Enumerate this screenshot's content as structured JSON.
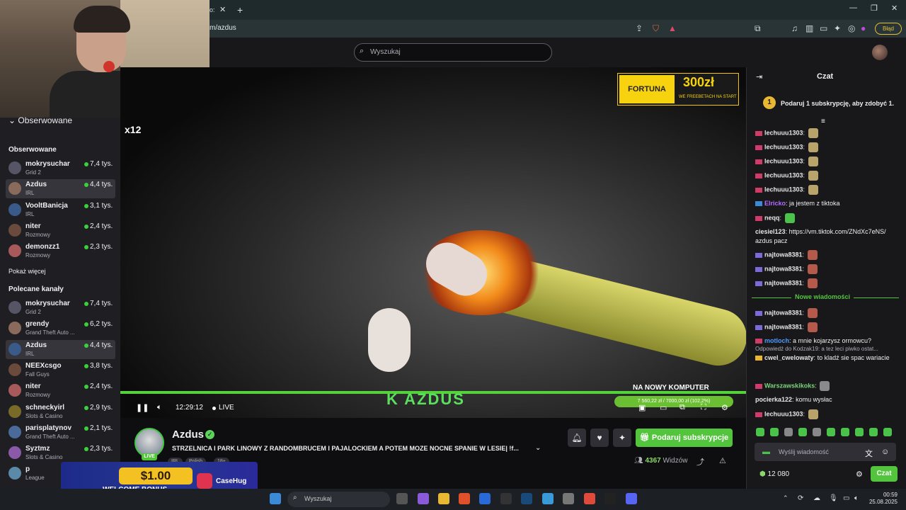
{
  "browser": {
    "tab_label": "o:",
    "url": "m/azdus",
    "error_badge": "Błąd"
  },
  "topnav": {
    "search_placeholder": "Wyszukaj"
  },
  "sidebar": {
    "followed_toggle": "Obserwowane",
    "followed_heading": "Obserwowane",
    "followed": [
      {
        "name": "mokrysuchar",
        "category": "Grid 2",
        "viewers": "7,4 tys."
      },
      {
        "name": "Azdus",
        "category": "IRL",
        "viewers": "4,4 tys."
      },
      {
        "name": "VooltBanicja",
        "category": "IRL",
        "viewers": "3,1 tys."
      },
      {
        "name": "niter",
        "category": "Rozmowy",
        "viewers": "2,4 tys."
      },
      {
        "name": "demonzz1",
        "category": "Rozmowy",
        "viewers": "2,3 tys."
      }
    ],
    "show_more": "Pokaż więcej",
    "recommended_heading": "Polecane kanały",
    "recommended": [
      {
        "name": "mokrysuchar",
        "category": "Grid 2",
        "viewers": "7,4 tys."
      },
      {
        "name": "grendy",
        "category": "Grand Theft Auto ...",
        "viewers": "6,2 tys."
      },
      {
        "name": "Azdus",
        "category": "IRL",
        "viewers": "4,4 tys."
      },
      {
        "name": "NEEXcsgo",
        "category": "Fall Guys",
        "viewers": "3,8 tys."
      },
      {
        "name": "niter",
        "category": "Rozmowy",
        "viewers": "2,4 tys."
      },
      {
        "name": "schneckyirl",
        "category": "Slots & Casino",
        "viewers": "2,9 tys."
      },
      {
        "name": "parisplatynov",
        "category": "Grand Theft Auto ...",
        "viewers": "2,1 tys."
      },
      {
        "name": "Syztmz",
        "category": "Slots & Casino",
        "viewers": "2,3 tys."
      },
      {
        "name": "p",
        "category": "League",
        "viewers": ""
      }
    ]
  },
  "video": {
    "overlay_x12": "x12",
    "sponsor_logo": "FORTUNA",
    "sponsor_amount": "300zł",
    "sponsor_sub": "WE FREEBETACH NA START",
    "overlay_brand": "K AZDUS",
    "goal_title": "NA NOWY KOMPUTER",
    "goal_progress": "7 560,22 zł / 7000,00 zł (102,2%)",
    "time": "12:29:12",
    "live_label": "LIVE"
  },
  "stream": {
    "streamer": "Azdus",
    "live_badge": "LIVE",
    "title": "STRZELNICA I PARK LINOWY Z RANDOMBRUCEM I PAJALOCKIEM A POTEM MOZE NOCNE SPANIE W LESIE| !f...",
    "tags": [
      "IRL",
      "Polish",
      "18+"
    ],
    "subscribe_label": "Podaruj subskrypcje",
    "viewer_count": "4367",
    "viewer_label": "Widzów"
  },
  "ad": {
    "amount": "$1.00",
    "bonus": "WELCOME BONUS",
    "brand": "CaseHug"
  },
  "chat": {
    "title": "Czat",
    "promo_number": "1",
    "promo_text": "Podaruj 1 subskrypcję, aby zdobyć 1.",
    "new_messages": "Nowe wiadomości",
    "messages": [
      {
        "user": "lechuuu1303",
        "text": "",
        "user_color": "#e6e6e6",
        "badge_color": "#d13b6a",
        "emote": "#b8a36a"
      },
      {
        "user": "lechuuu1303",
        "text": "",
        "user_color": "#e6e6e6",
        "badge_color": "#d13b6a",
        "emote": "#b8a36a"
      },
      {
        "user": "lechuuu1303",
        "text": "",
        "user_color": "#e6e6e6",
        "badge_color": "#d13b6a",
        "emote": "#b8a36a"
      },
      {
        "user": "lechuuu1303",
        "text": "",
        "user_color": "#e6e6e6",
        "badge_color": "#d13b6a",
        "emote": "#b8a36a"
      },
      {
        "user": "lechuuu1303",
        "text": "",
        "user_color": "#e6e6e6",
        "badge_color": "#d13b6a",
        "emote": "#b8a36a"
      },
      {
        "user": "Elricko",
        "text": "ja jestem z tiktoka",
        "user_color": "#b36bff",
        "badge_color": "#3a8ad8",
        "emote": ""
      },
      {
        "user": "neqq",
        "text": "",
        "user_color": "#e6e6e6",
        "badge_color": "#d13b6a",
        "emote": "#4bc34b"
      },
      {
        "user": "ciesiel123",
        "text": "https://vm.tiktok.com/ZNdXc7eNS/ azdus pacz",
        "user_color": "#e6e6e6",
        "badge_color": "",
        "emote": ""
      },
      {
        "user": "najtowa8381",
        "text": "",
        "user_color": "#e6e6e6",
        "badge_color": "#7b6bd8",
        "emote": "#b5594a"
      },
      {
        "user": "najtowa8381",
        "text": "",
        "user_color": "#e6e6e6",
        "badge_color": "#7b6bd8",
        "emote": "#b5594a"
      },
      {
        "user": "najtowa8381",
        "text": "",
        "user_color": "#e6e6e6",
        "badge_color": "#7b6bd8",
        "emote": "#b5594a"
      },
      {
        "user": "najtowa8381",
        "text": "",
        "user_color": "#e6e6e6",
        "badge_color": "#7b6bd8",
        "emote": "#b5594a"
      },
      {
        "user": "najtowa8381",
        "text": "",
        "user_color": "#e6e6e6",
        "badge_color": "#7b6bd8",
        "emote": "#b5594a"
      },
      {
        "user": "motloch",
        "text": "a mnie kojarzysz ormowcu?",
        "user_color": "#4d9bff",
        "badge_color": "#d13b6a",
        "emote": ""
      },
      {
        "user": "cwel_cwelowaty",
        "text": "to kladź sie spac wariacie",
        "reply": "Odpowiedź do Kodzak19: a tez leci piwko ostat...",
        "user_color": "#e6e6e6",
        "badge_color": "#e8b833",
        "emote": ""
      },
      {
        "user": "Warszawskikoks",
        "text": "",
        "user_color": "#7bd67b",
        "badge_color": "#d13b6a",
        "emote": "#8a8a8a"
      },
      {
        "user": "pocierka122",
        "text": "komu wysłac",
        "user_color": "#e6e6e6",
        "badge_color": "",
        "emote": ""
      },
      {
        "user": "lechuuu1303",
        "text": "",
        "user_color": "#e6e6e6",
        "badge_color": "#d13b6a",
        "emote": "#b8a36a"
      }
    ],
    "input_placeholder": "Wyślij wiadomość",
    "points": "12 080",
    "send_label": "Czat"
  },
  "taskbar": {
    "search_placeholder": "Wyszukaj",
    "time": "00:59",
    "date": "25.08.2025"
  },
  "colors": {
    "accent": "#53c53c",
    "background": "#0e0e10",
    "sidebar": "#1f1f23"
  }
}
